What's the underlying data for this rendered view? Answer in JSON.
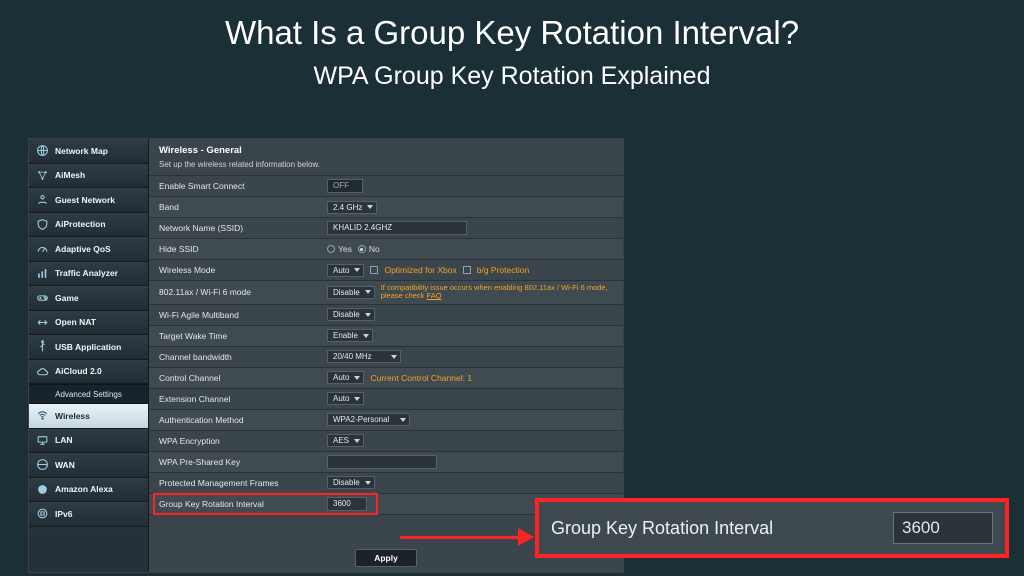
{
  "titles": {
    "main": "What Is a Group Key Rotation Interval?",
    "sub": "WPA Group Key Rotation Explained"
  },
  "sidebar": {
    "items": [
      {
        "label": "Network Map",
        "icon": "globe"
      },
      {
        "label": "AiMesh",
        "icon": "mesh"
      },
      {
        "label": "Guest Network",
        "icon": "guest"
      },
      {
        "label": "AiProtection",
        "icon": "shield"
      },
      {
        "label": "Adaptive QoS",
        "icon": "meter"
      },
      {
        "label": "Traffic Analyzer",
        "icon": "chart"
      },
      {
        "label": "Game",
        "icon": "gamepad"
      },
      {
        "label": "Open NAT",
        "icon": "nat"
      },
      {
        "label": "USB Application",
        "icon": "usb"
      },
      {
        "label": "AiCloud 2.0",
        "icon": "cloud"
      }
    ],
    "adv_header": "Advanced Settings",
    "adv_items": [
      {
        "label": "Wireless",
        "icon": "wifi",
        "active": true
      },
      {
        "label": "LAN",
        "icon": "lan"
      },
      {
        "label": "WAN",
        "icon": "wan"
      },
      {
        "label": "Amazon Alexa",
        "icon": "alexa"
      },
      {
        "label": "IPv6",
        "icon": "ipv6"
      }
    ]
  },
  "panel": {
    "title": "Wireless - General",
    "subtitle": "Set up the wireless related information below.",
    "smart_connect_label": "Enable Smart Connect",
    "smart_connect_value": "OFF",
    "band_label": "Band",
    "band_value": "2.4 GHz",
    "ssid_label": "Network Name (SSID)",
    "ssid_value": "KHALID 2.4GHZ",
    "hide_ssid_label": "Hide SSID",
    "hide_ssid_yes": "Yes",
    "hide_ssid_no": "No",
    "wmode_label": "Wireless Mode",
    "wmode_value": "Auto",
    "wmode_xbox": "Optimized for Xbox",
    "wmode_bg": "b/g Protection",
    "ax_label": "802.11ax / Wi-Fi 6 mode",
    "ax_value": "Disable",
    "ax_note": "If compatibility issue occurs when enabling 802.11ax / Wi-Fi 6 mode, please check ",
    "ax_faq": "FAQ",
    "agile_label": "Wi-Fi Agile Multiband",
    "agile_value": "Disable",
    "twt_label": "Target Wake Time",
    "twt_value": "Enable",
    "cbw_label": "Channel bandwidth",
    "cbw_value": "20/40 MHz",
    "cch_label": "Control Channel",
    "cch_value": "Auto",
    "cch_note": "Current Control Channel: 1",
    "ext_label": "Extension Channel",
    "ext_value": "Auto",
    "auth_label": "Authentication Method",
    "auth_value": "WPA2-Personal",
    "enc_label": "WPA Encryption",
    "enc_value": "AES",
    "psk_label": "WPA Pre-Shared Key",
    "pmf_label": "Protected Management Frames",
    "pmf_value": "Disable",
    "gkri_label": "Group Key Rotation Interval",
    "gkri_value": "3600",
    "apply": "Apply"
  },
  "zoom": {
    "label": "Group Key Rotation Interval",
    "value": "3600"
  }
}
